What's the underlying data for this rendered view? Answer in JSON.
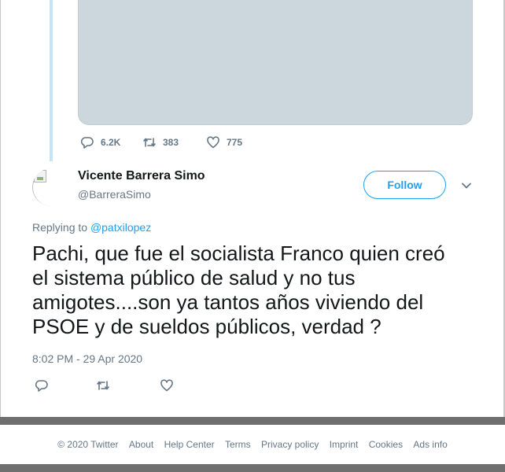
{
  "previous_tweet": {
    "actions": {
      "replies": "6.2K",
      "retweets": "383",
      "likes": "775"
    }
  },
  "tweet": {
    "author_name": "Vicente Barrera Simo",
    "author_handle": "@BarreraSimo",
    "follow_label": "Follow",
    "replying_prefix": "Replying to",
    "replying_to": "@patxilopez",
    "text": "Pachi, que fue el socialista Franco quien creó\nel sistema público de salud y no tus\namigotes....son ya tantos años viviendo del\nPSOE y de sueldos públicos, verdad ?",
    "timestamp": "8:02 PM - 29 Apr 2020"
  },
  "footer": {
    "links": [
      "© 2020 Twitter",
      "About",
      "Help Center",
      "Terms",
      "Privacy policy",
      "Imprint",
      "Cookies",
      "Ads info"
    ]
  },
  "colors": {
    "accent": "#1da1f2",
    "muted_text": "#657786",
    "media_placeholder": "#ccd6dd"
  }
}
